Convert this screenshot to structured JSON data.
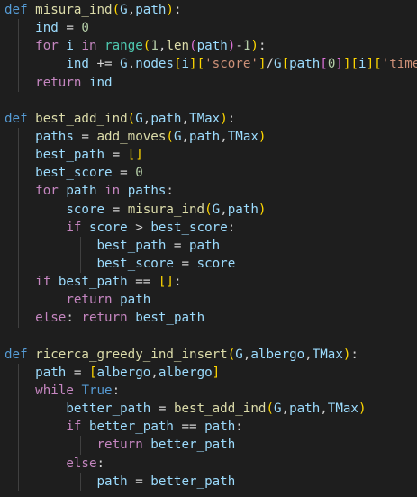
{
  "editor": {
    "lines": [
      {
        "indent": 0,
        "tokens": [
          [
            "def",
            "k"
          ],
          [
            " ",
            "p"
          ],
          [
            "misura_ind",
            "f"
          ],
          [
            "(",
            "y"
          ],
          [
            "G",
            "v"
          ],
          [
            ",",
            "p"
          ],
          [
            "path",
            "v"
          ],
          [
            ")",
            "y"
          ],
          [
            ":",
            "p"
          ]
        ]
      },
      {
        "indent": 1,
        "tokens": [
          [
            "ind",
            "v"
          ],
          [
            " = ",
            "p"
          ],
          [
            "0",
            "n"
          ]
        ]
      },
      {
        "indent": 1,
        "tokens": [
          [
            "for",
            "c"
          ],
          [
            " ",
            "p"
          ],
          [
            "i",
            "v"
          ],
          [
            " ",
            "p"
          ],
          [
            "in",
            "c"
          ],
          [
            " ",
            "p"
          ],
          [
            "range",
            "b"
          ],
          [
            "(",
            "y"
          ],
          [
            "1",
            "n"
          ],
          [
            ",",
            "p"
          ],
          [
            "len",
            "f"
          ],
          [
            "(",
            "m"
          ],
          [
            "path",
            "v"
          ],
          [
            ")",
            "m"
          ],
          [
            "-",
            "p"
          ],
          [
            "1",
            "n"
          ],
          [
            ")",
            "y"
          ],
          [
            ":",
            "p"
          ]
        ]
      },
      {
        "indent": 2,
        "tokens": [
          [
            "ind",
            "v"
          ],
          [
            " += ",
            "p"
          ],
          [
            "G",
            "v"
          ],
          [
            ".",
            "p"
          ],
          [
            "nodes",
            "v"
          ],
          [
            "[",
            "y"
          ],
          [
            "i",
            "v"
          ],
          [
            "]",
            "y"
          ],
          [
            "[",
            "y"
          ],
          [
            "'score'",
            "s"
          ],
          [
            "]",
            "y"
          ],
          [
            "/",
            "p"
          ],
          [
            "G",
            "v"
          ],
          [
            "[",
            "y"
          ],
          [
            "path",
            "v"
          ],
          [
            "[",
            "m"
          ],
          [
            "0",
            "n"
          ],
          [
            "]",
            "m"
          ],
          [
            "]",
            "y"
          ],
          [
            "[",
            "y"
          ],
          [
            "i",
            "v"
          ],
          [
            "]",
            "y"
          ],
          [
            "[",
            "y"
          ],
          [
            "'time'",
            "s"
          ],
          [
            "]",
            "y"
          ]
        ]
      },
      {
        "indent": 1,
        "tokens": [
          [
            "return",
            "c"
          ],
          [
            " ",
            "p"
          ],
          [
            "ind",
            "v"
          ]
        ]
      },
      {
        "indent": 0,
        "tokens": []
      },
      {
        "indent": 0,
        "tokens": [
          [
            "def",
            "k"
          ],
          [
            " ",
            "p"
          ],
          [
            "best_add_ind",
            "f"
          ],
          [
            "(",
            "y"
          ],
          [
            "G",
            "v"
          ],
          [
            ",",
            "p"
          ],
          [
            "path",
            "v"
          ],
          [
            ",",
            "p"
          ],
          [
            "TMax",
            "v"
          ],
          [
            ")",
            "y"
          ],
          [
            ":",
            "p"
          ]
        ]
      },
      {
        "indent": 1,
        "tokens": [
          [
            "paths",
            "v"
          ],
          [
            " = ",
            "p"
          ],
          [
            "add_moves",
            "f"
          ],
          [
            "(",
            "y"
          ],
          [
            "G",
            "v"
          ],
          [
            ",",
            "p"
          ],
          [
            "path",
            "v"
          ],
          [
            ",",
            "p"
          ],
          [
            "TMax",
            "v"
          ],
          [
            ")",
            "y"
          ]
        ]
      },
      {
        "indent": 1,
        "tokens": [
          [
            "best_path",
            "v"
          ],
          [
            " = ",
            "p"
          ],
          [
            "[]",
            "y"
          ]
        ]
      },
      {
        "indent": 1,
        "tokens": [
          [
            "best_score",
            "v"
          ],
          [
            " = ",
            "p"
          ],
          [
            "0",
            "n"
          ]
        ]
      },
      {
        "indent": 1,
        "tokens": [
          [
            "for",
            "c"
          ],
          [
            " ",
            "p"
          ],
          [
            "path",
            "v"
          ],
          [
            " ",
            "p"
          ],
          [
            "in",
            "c"
          ],
          [
            " ",
            "p"
          ],
          [
            "paths",
            "v"
          ],
          [
            ":",
            "p"
          ]
        ]
      },
      {
        "indent": 2,
        "tokens": [
          [
            "score",
            "v"
          ],
          [
            " = ",
            "p"
          ],
          [
            "misura_ind",
            "f"
          ],
          [
            "(",
            "y"
          ],
          [
            "G",
            "v"
          ],
          [
            ",",
            "p"
          ],
          [
            "path",
            "v"
          ],
          [
            ")",
            "y"
          ]
        ]
      },
      {
        "indent": 2,
        "tokens": [
          [
            "if",
            "c"
          ],
          [
            " ",
            "p"
          ],
          [
            "score",
            "v"
          ],
          [
            " > ",
            "p"
          ],
          [
            "best_score",
            "v"
          ],
          [
            ":",
            "p"
          ]
        ]
      },
      {
        "indent": 3,
        "tokens": [
          [
            "best_path",
            "v"
          ],
          [
            " = ",
            "p"
          ],
          [
            "path",
            "v"
          ]
        ]
      },
      {
        "indent": 3,
        "tokens": [
          [
            "best_score",
            "v"
          ],
          [
            " = ",
            "p"
          ],
          [
            "score",
            "v"
          ]
        ]
      },
      {
        "indent": 1,
        "tokens": [
          [
            "if",
            "c"
          ],
          [
            " ",
            "p"
          ],
          [
            "best_path",
            "v"
          ],
          [
            " == ",
            "p"
          ],
          [
            "[]",
            "y"
          ],
          [
            ":",
            "p"
          ]
        ]
      },
      {
        "indent": 2,
        "tokens": [
          [
            "return",
            "c"
          ],
          [
            " ",
            "p"
          ],
          [
            "path",
            "v"
          ]
        ]
      },
      {
        "indent": 1,
        "tokens": [
          [
            "else",
            "c"
          ],
          [
            ": ",
            "p"
          ],
          [
            "return",
            "c"
          ],
          [
            " ",
            "p"
          ],
          [
            "best_path",
            "v"
          ]
        ]
      },
      {
        "indent": 0,
        "tokens": []
      },
      {
        "indent": 0,
        "tokens": [
          [
            "def",
            "k"
          ],
          [
            " ",
            "p"
          ],
          [
            "ricerca_greedy_ind_insert",
            "f"
          ],
          [
            "(",
            "y"
          ],
          [
            "G",
            "v"
          ],
          [
            ",",
            "p"
          ],
          [
            "albergo",
            "v"
          ],
          [
            ",",
            "p"
          ],
          [
            "TMax",
            "v"
          ],
          [
            ")",
            "y"
          ],
          [
            ":",
            "p"
          ]
        ]
      },
      {
        "indent": 1,
        "tokens": [
          [
            "path",
            "v"
          ],
          [
            " = ",
            "p"
          ],
          [
            "[",
            "y"
          ],
          [
            "albergo",
            "v"
          ],
          [
            ",",
            "p"
          ],
          [
            "albergo",
            "v"
          ],
          [
            "]",
            "y"
          ]
        ]
      },
      {
        "indent": 1,
        "tokens": [
          [
            "while",
            "c"
          ],
          [
            " ",
            "p"
          ],
          [
            "True",
            "k"
          ],
          [
            ":",
            "p"
          ]
        ]
      },
      {
        "indent": 2,
        "tokens": [
          [
            "better_path",
            "v"
          ],
          [
            " = ",
            "p"
          ],
          [
            "best_add_ind",
            "f"
          ],
          [
            "(",
            "y"
          ],
          [
            "G",
            "v"
          ],
          [
            ",",
            "p"
          ],
          [
            "path",
            "v"
          ],
          [
            ",",
            "p"
          ],
          [
            "TMax",
            "v"
          ],
          [
            ")",
            "y"
          ]
        ]
      },
      {
        "indent": 2,
        "tokens": [
          [
            "if",
            "c"
          ],
          [
            " ",
            "p"
          ],
          [
            "better_path",
            "v"
          ],
          [
            " == ",
            "p"
          ],
          [
            "path",
            "v"
          ],
          [
            ":",
            "p"
          ]
        ]
      },
      {
        "indent": 3,
        "tokens": [
          [
            "return",
            "c"
          ],
          [
            " ",
            "p"
          ],
          [
            "better_path",
            "v"
          ]
        ]
      },
      {
        "indent": 2,
        "tokens": [
          [
            "else",
            "c"
          ],
          [
            ":",
            "p"
          ]
        ]
      },
      {
        "indent": 3,
        "tokens": [
          [
            "path",
            "v"
          ],
          [
            " = ",
            "p"
          ],
          [
            "better_path",
            "v"
          ]
        ]
      }
    ]
  }
}
